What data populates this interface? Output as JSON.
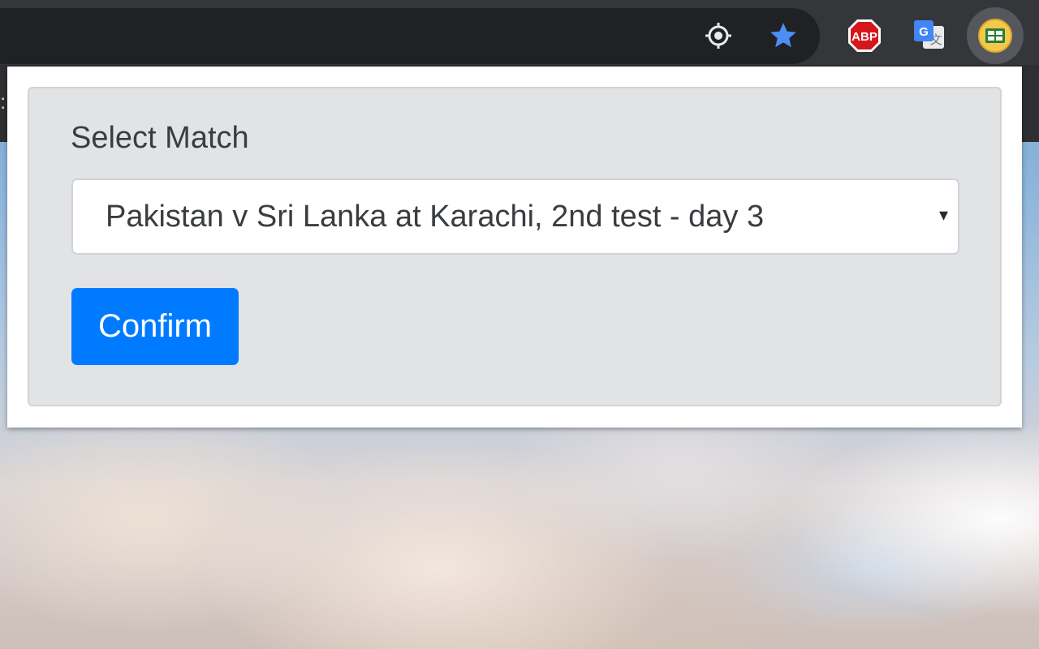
{
  "browser": {
    "toolbar_icons": [
      {
        "name": "location-icon",
        "color": "#e8eaed"
      },
      {
        "name": "bookmark-star-icon",
        "color": "#4c8df6"
      },
      {
        "name": "adblock-plus-icon",
        "label": "ABP",
        "color": "#d6161b"
      },
      {
        "name": "google-translate-icon",
        "label": "G",
        "color": "#4285f4"
      },
      {
        "name": "extension-scoreboard-icon",
        "color": "#f2c94c"
      }
    ]
  },
  "popup": {
    "title": "Select Match",
    "select": {
      "selected": "Pakistan v Sri Lanka at Karachi, 2nd test - day 3",
      "caret": "▾"
    },
    "confirm_label": "Confirm",
    "colors": {
      "primary": "#007bff",
      "card_bg": "#e2e3e5"
    }
  }
}
